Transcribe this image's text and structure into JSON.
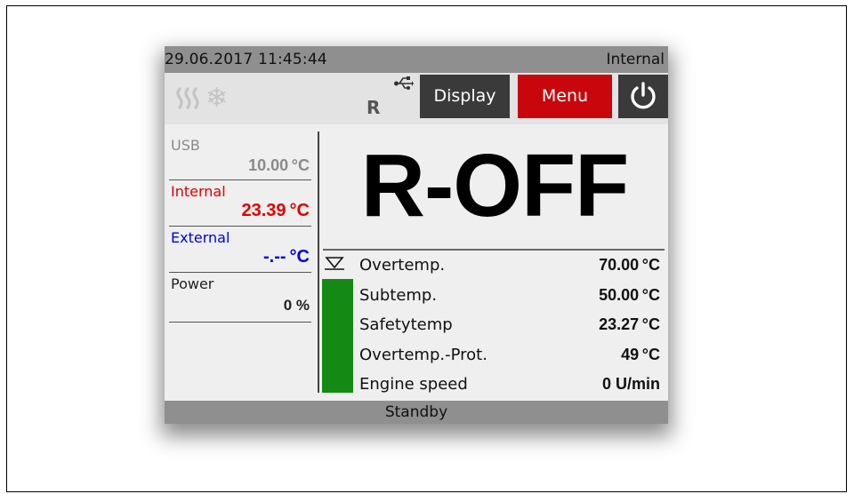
{
  "header": {
    "datetime": "29.06.2017 11:45:44",
    "source": "Internal"
  },
  "toolbar": {
    "mode_letter": "R",
    "display_label": "Display",
    "menu_label": "Menu",
    "icons": [
      "heating-icon",
      "cooling-icon",
      "usb-icon",
      "power-icon"
    ]
  },
  "sensors": [
    {
      "name": "USB",
      "value": "10.00 °C",
      "name_color": "#8a8a8a",
      "value_color": "#8a8a8a"
    },
    {
      "name": "Internal",
      "value": "23.39 °C",
      "name_color": "#e00000",
      "value_color": "#e00000"
    },
    {
      "name": "External",
      "value": "-.-- °C",
      "name_color": "#0000e0",
      "value_color": "#0000e0"
    },
    {
      "name": "Power",
      "value": "0 %",
      "name_color": "#222222",
      "value_color": "#222222"
    }
  ],
  "main": {
    "state": "R-OFF"
  },
  "parameters": [
    {
      "label": "Overtemp.",
      "value": "70.00 °C"
    },
    {
      "label": "Subtemp.",
      "value": "50.00 °C"
    },
    {
      "label": "Safetytemp",
      "value": "23.27 °C"
    },
    {
      "label": "Overtemp.-Prot.",
      "value": "49 °C"
    },
    {
      "label": "Engine speed",
      "value": "0 U/min"
    }
  ],
  "level": {
    "fill_fraction": 0.85,
    "color": "#138a13"
  },
  "status": {
    "text": "Standby"
  },
  "colors": {
    "menu_button": "#c8060c",
    "dark_button": "#3a3a3a",
    "bar": "#8f8f8f"
  }
}
